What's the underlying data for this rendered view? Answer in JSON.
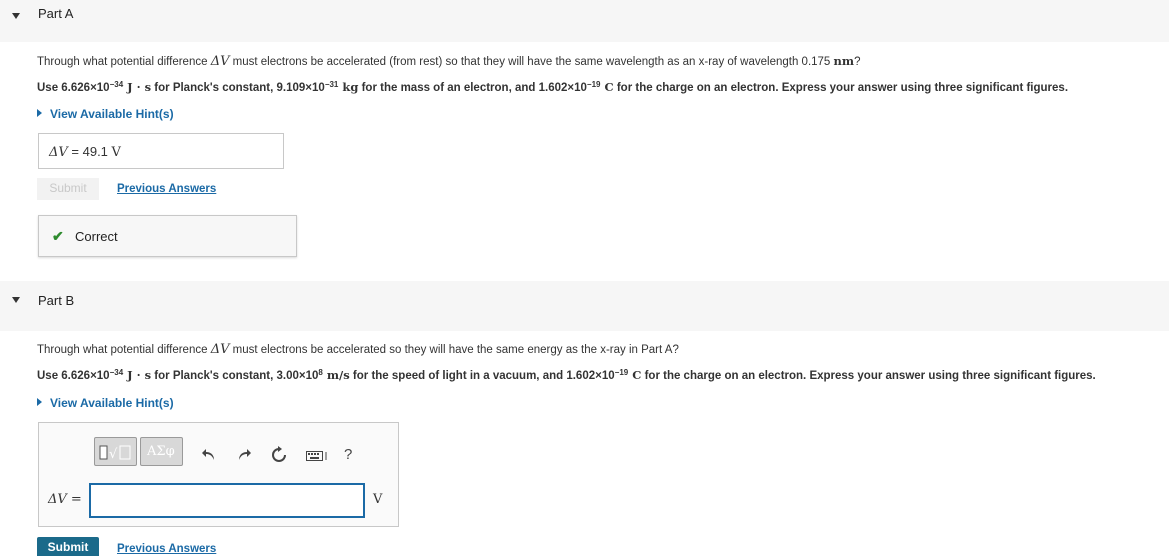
{
  "partA": {
    "title": "Part A",
    "question_line1": {
      "pre": "Through what potential difference ",
      "symbol": "ΔV",
      "mid": " must electrons be accelerated (from rest) so that they will have the same wavelength as an x-ray of wavelength 0.175 ",
      "unit": "nm",
      "post": "?"
    },
    "question_line2": {
      "t1": "Use 6.626×10",
      "e1": "−34",
      "u1": " J · s",
      "t2": " for Planck's constant, 9.109×10",
      "e2": "−31",
      "u2": " kg",
      "t3": " for the mass of an electron, and 1.602×10",
      "e3": "−19",
      "u3": " C",
      "t4": " for the charge on an electron. Express your answer using three significant figures."
    },
    "hint_label": "View Available Hint(s)",
    "answer": {
      "symbol": "ΔV",
      "eq": " = ",
      "value": "49.1",
      "unit": "V"
    },
    "submit_label": "Submit",
    "previous_answers_label": "Previous Answers",
    "feedback": "Correct"
  },
  "partB": {
    "title": "Part B",
    "question_line1": {
      "pre": "Through what potential difference ",
      "symbol": "ΔV",
      "post": " must electrons be accelerated so they will have the same energy as the x-ray in Part A?"
    },
    "question_line2": {
      "t1": "Use 6.626×10",
      "e1": "−34",
      "u1": " J · s",
      "t2": " for Planck's constant, 3.00×10",
      "e2": "8",
      "u2": " m/s",
      "t3": " for the speed of light in a vacuum, and 1.602×10",
      "e3": "−19",
      "u3": " C",
      "t4": " for the charge on an electron. Express your answer using three significant figures."
    },
    "hint_label": "View Available Hint(s)",
    "toolbar": {
      "greek_label": "ΑΣφ",
      "help_label": "?"
    },
    "input_label": "ΔV =",
    "input_value": "",
    "unit": "V",
    "submit_label": "Submit",
    "previous_answers_label": "Previous Answers"
  },
  "colors": {
    "link": "#1b6aa6",
    "submit": "#1b6a8a",
    "correct_check": "#2e8b2e",
    "header_bg": "#f6f6f6"
  }
}
